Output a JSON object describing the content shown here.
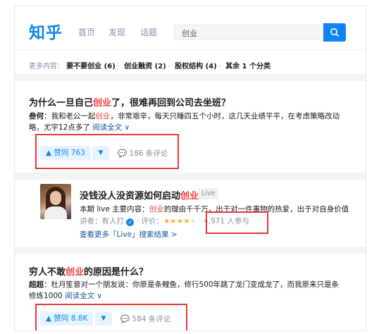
{
  "header": {
    "logo": "知乎",
    "nav": [
      "首页",
      "发现",
      "话题"
    ],
    "search_value": "创业"
  },
  "more": {
    "label": "更多内容：",
    "items": [
      "要不要创业 (6)",
      "创业融资 (2)",
      "股权结构 (4)",
      "其余 1 个分类"
    ]
  },
  "answers": [
    {
      "title_pre": "为什么一旦自己",
      "title_hl": "创业",
      "title_post": "了，很难再回到公司去坐班？",
      "author": "叁何",
      "excerpt_pre": "：我和老公一起",
      "excerpt_hl": "创业",
      "excerpt_post": "，非常艰辛，每天只睡四五个小时，这几天业绩平平，在考虑策略改动",
      "excerpt_line2": "略，尤宇12点多了",
      "read_more": "阅读全文 ∨",
      "votes": "▲ 赞同 763",
      "vote_down": "▼",
      "comments": "186 条评论"
    },
    {
      "title_pre": "穷人不敢",
      "title_hl": "创业",
      "title_post": "的原因是什么？",
      "author": "超超",
      "excerpt_pre": "：杜月笙曾对一个朋友说：你原是条鲤鱼，修行500年跳了龙门变成龙了，而我原来只是条",
      "excerpt_line2": "修炼1000",
      "read_more": "阅读全文 ∨",
      "votes": "▲ 赞同 8.8K",
      "vote_down": "▼",
      "comments": "584 条评论"
    }
  ],
  "live": {
    "title_pre": "没钱没人没资源如何启动",
    "title_hl": "创业",
    "badge": "Live",
    "desc_pre": "本期 live 主要内容：",
    "desc_hl": "创业",
    "desc_post": "的理由千千万，出于对一件事物的热爱，出于对自身价值",
    "speaker_label": "讲者：有人打",
    "rating_label": "· 评价：",
    "stars": "★★★★",
    "star_half": "★",
    "participants": "· 4,971 人参与",
    "see_more": "查看更多「Live」搜索结果 >"
  },
  "colors": {
    "brand": "#0f88eb",
    "highlight": "#f1403c",
    "annotation": "#e53935"
  }
}
